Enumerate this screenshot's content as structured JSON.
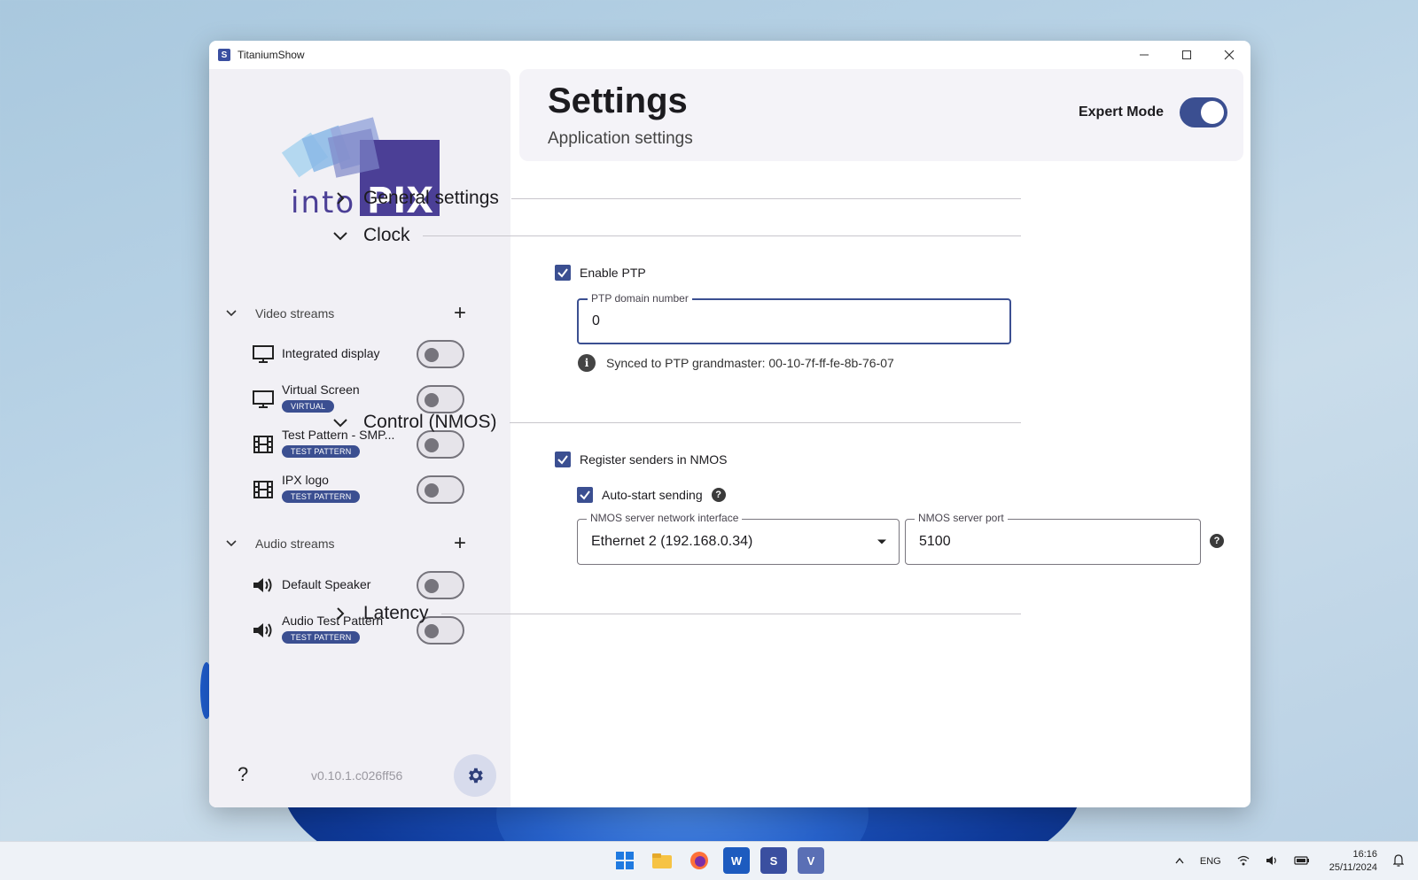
{
  "window": {
    "title": "TitaniumShow"
  },
  "colors": {
    "accent": "#3b4f91",
    "sidebar_bg": "#f1f0f5",
    "header_bg": "#f4f3f8"
  },
  "sidebar": {
    "logo_text_left": "into",
    "logo_text_right": "PIX",
    "video_section": "Video streams",
    "audio_section": "Audio streams",
    "video_streams": [
      {
        "name": "Integrated display",
        "badge": "",
        "icon": "monitor-icon",
        "enabled": false
      },
      {
        "name": "Virtual Screen",
        "badge": "VIRTUAL",
        "icon": "monitor-icon",
        "enabled": false
      },
      {
        "name": "Test Pattern - SMP...",
        "badge": "TEST PATTERN",
        "icon": "film-icon",
        "enabled": false
      },
      {
        "name": "IPX logo",
        "badge": "TEST PATTERN",
        "icon": "film-icon",
        "enabled": false
      }
    ],
    "audio_streams": [
      {
        "name": "Default Speaker",
        "badge": "",
        "icon": "speaker-icon",
        "enabled": false
      },
      {
        "name": "Audio Test Pattern",
        "badge": "TEST PATTERN",
        "icon": "speaker-icon",
        "enabled": false
      }
    ],
    "help": "?",
    "version": "v0.10.1.c026ff56"
  },
  "header": {
    "title": "Settings",
    "subtitle": "Application settings",
    "expert_mode_label": "Expert Mode",
    "expert_mode_on": true
  },
  "groups": {
    "general": "General settings",
    "clock": "Clock",
    "control": "Control (NMOS)",
    "latency": "Latency"
  },
  "clock": {
    "enable_ptp_label": "Enable PTP",
    "enable_ptp": true,
    "ptp_domain_label": "PTP domain number",
    "ptp_domain_value": "0",
    "sync_info": "Synced to PTP grandmaster: 00-10-7f-ff-fe-8b-76-07"
  },
  "nmos": {
    "register_label": "Register senders in NMOS",
    "register": true,
    "autostart_label": "Auto-start sending",
    "autostart": true,
    "interface_label": "NMOS server network interface",
    "interface_value": "Ethernet 2 (192.168.0.34)",
    "port_label": "NMOS server port",
    "port_value": "5100"
  },
  "taskbar": {
    "language": "ENG",
    "time": "16:16",
    "date": "25/11/2024"
  }
}
